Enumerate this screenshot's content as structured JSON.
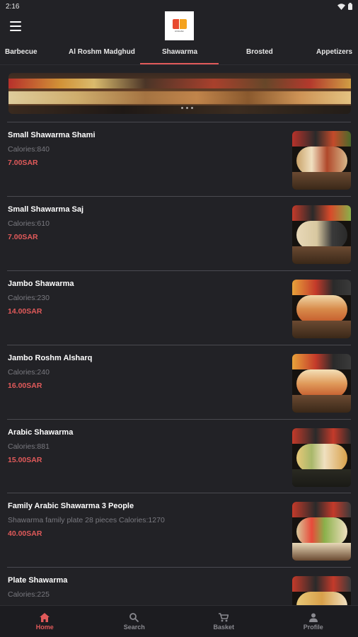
{
  "status_bar": {
    "time": "2:16"
  },
  "header": {
    "logo_text": "Al Roshm"
  },
  "tabs": [
    {
      "label": "Barbecue"
    },
    {
      "label": "Al Roshm Madghud"
    },
    {
      "label": "Shawarma",
      "active": true
    },
    {
      "label": "Brosted"
    },
    {
      "label": "Appetizers"
    }
  ],
  "items": [
    {
      "name": "Small Shawarma Shami",
      "desc": "Calories:840",
      "price": "7.00SAR"
    },
    {
      "name": "Small Shawarma Saj",
      "desc": "Calories:610",
      "price": "7.00SAR"
    },
    {
      "name": "Jambo Shawarma",
      "desc": "Calories:230",
      "price": "14.00SAR"
    },
    {
      "name": "Jambo Roshm Alsharq",
      "desc": "Calories:240",
      "price": "16.00SAR"
    },
    {
      "name": "Arabic Shawarma",
      "desc": "Calories:881",
      "price": "15.00SAR"
    },
    {
      "name": "Family Arabic Shawarma 3 People",
      "desc": "Shawarma family plate 28 pieces Calories:1270",
      "price": "40.00SAR"
    },
    {
      "name": "Plate Shawarma",
      "desc": "Calories:225",
      "price": ""
    }
  ],
  "bottom_nav": [
    {
      "label": "Home",
      "icon": "home-icon",
      "active": true
    },
    {
      "label": "Search",
      "icon": "search-icon"
    },
    {
      "label": "Basket",
      "icon": "cart-icon"
    },
    {
      "label": "Profile",
      "icon": "person-icon"
    }
  ],
  "colors": {
    "accent": "#e15a5a",
    "background": "#222226",
    "muted": "#7a7a80"
  }
}
